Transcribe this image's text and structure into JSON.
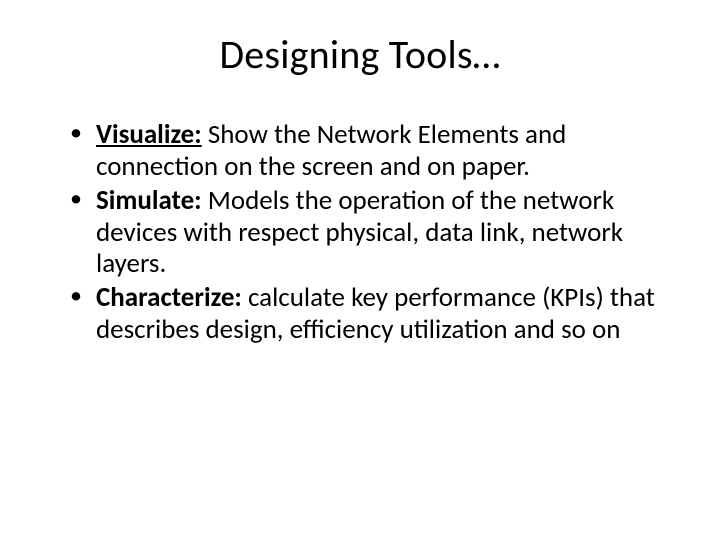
{
  "title": "Designing Tools…",
  "bullets": [
    {
      "term": "Visualize:",
      "text": " Show the Network Elements and connection on the screen and on paper."
    },
    {
      "term": "Simulate:",
      "text": " Models the operation of the network devices with respect physical, data link, network layers."
    },
    {
      "term": "Characterize:",
      "text": "  calculate key performance (KPIs) that describes design, efficiency utilization and so on"
    }
  ]
}
